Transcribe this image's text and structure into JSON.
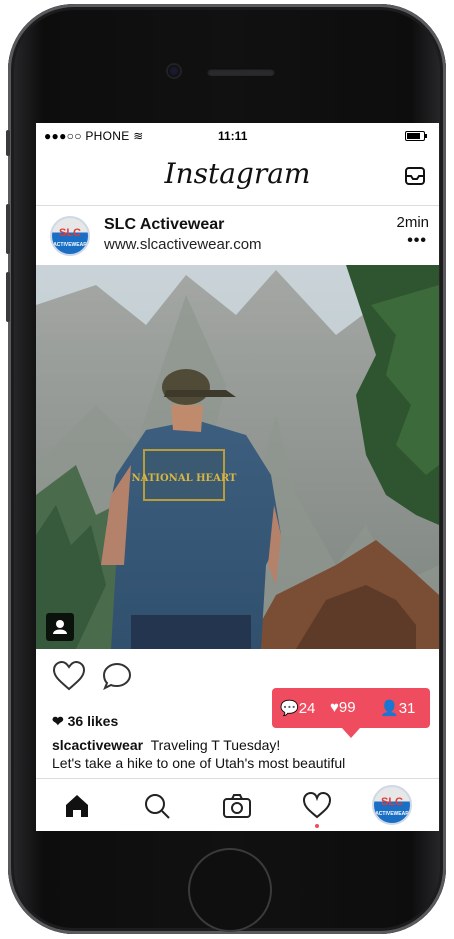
{
  "status": {
    "carrier": "●●●○○ PHONE",
    "time": "11:11"
  },
  "app": {
    "title": "Instagram"
  },
  "post": {
    "avatar_text": "SLC",
    "avatar_sub": "ACTIVEWEAR",
    "username": "SLC Activewear",
    "website": "www.slcactivewear.com",
    "time_ago": "2min",
    "more": "•••",
    "likes": "36 likes",
    "caption_user": "slcactivewear",
    "caption_text": "Traveling T Tuesday!",
    "caption_line2": "Let's take a hike to one of Utah's most beautiful"
  },
  "notifications": {
    "comments": "24",
    "likes": "99",
    "followers": "31"
  },
  "icons": [
    "inbox-icon",
    "heart-icon",
    "comment-icon",
    "home-icon",
    "search-icon",
    "camera-icon",
    "activity-icon",
    "profile-icon",
    "user-tag-icon"
  ],
  "colors": {
    "accent": "#ef4c60",
    "brand_blue": "#1a6fc4"
  }
}
